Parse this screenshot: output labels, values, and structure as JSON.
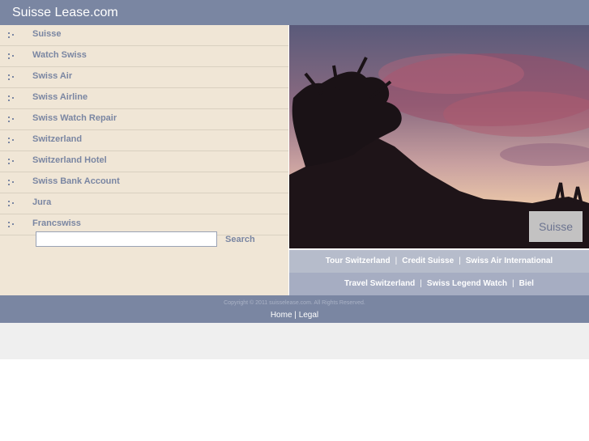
{
  "header": {
    "title": "Suisse Lease.com"
  },
  "nav": {
    "items": [
      {
        "label": "Suisse"
      },
      {
        "label": "Watch Swiss"
      },
      {
        "label": "Swiss Air"
      },
      {
        "label": "Swiss Airline"
      },
      {
        "label": "Swiss Watch Repair"
      },
      {
        "label": "Switzerland"
      },
      {
        "label": "Switzerland Hotel"
      },
      {
        "label": "Swiss Bank Account"
      },
      {
        "label": "Jura"
      },
      {
        "label": "Francswiss"
      }
    ]
  },
  "search": {
    "value": "",
    "button_label": "Search"
  },
  "hero": {
    "caption": "Suisse"
  },
  "links": {
    "row1": [
      "Tour Switzerland",
      "Credit Suisse",
      "Swiss Air International"
    ],
    "row2": [
      "Travel Switzerland",
      "Swiss Legend Watch",
      "Biel"
    ],
    "separator": "|"
  },
  "footer": {
    "copyright": "Copyright © 2011 suisselease.com. All Rights Reserved.",
    "home": "Home",
    "separator": "|",
    "legal": "Legal"
  },
  "colors": {
    "header_bg": "#7a86a2",
    "sidebar_bg": "#f0e6d6",
    "nav_text": "#7a86a2",
    "links_row1_bg": "#b6bccb",
    "links_row2_bg": "#a6adc2",
    "bottom_band": "#efefef"
  }
}
